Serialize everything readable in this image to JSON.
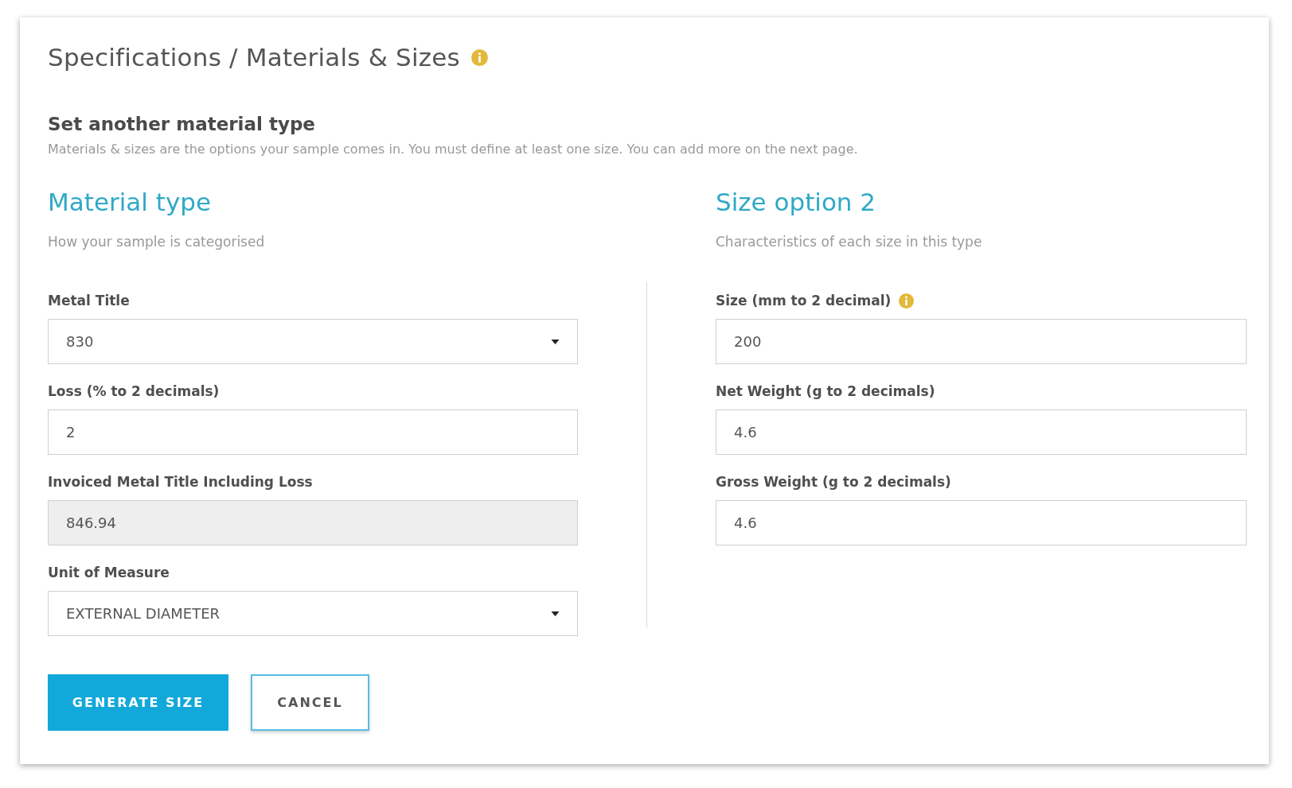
{
  "page_title": {
    "text": "Specifications / Materials & Sizes",
    "info": true
  },
  "section": {
    "heading": "Set another material type",
    "description": "Materials & sizes are the options your sample comes in. You must define at least one size. You can add more on the next page."
  },
  "columns": [
    {
      "title": "Material type",
      "subtitle": "How your sample is categorised",
      "fields": [
        {
          "label": "Metal Title",
          "kind": "select",
          "value": "830",
          "info": false,
          "disabled": false
        },
        {
          "label": "Loss (% to 2 decimals)",
          "kind": "text",
          "value": "2",
          "info": false,
          "disabled": false
        },
        {
          "label": "Invoiced Metal Title Including Loss",
          "kind": "text",
          "value": "846.94",
          "info": false,
          "disabled": true
        },
        {
          "label": "Unit of Measure",
          "kind": "select",
          "value": "EXTERNAL DIAMETER",
          "info": false,
          "disabled": false
        }
      ]
    },
    {
      "title": "Size option 2",
      "subtitle": "Characteristics of each size in this type",
      "fields": [
        {
          "label": "Size (mm to 2 decimal)",
          "kind": "text",
          "value": "200",
          "info": true,
          "disabled": false
        },
        {
          "label": "Net Weight (g to 2 decimals)",
          "kind": "text",
          "value": "4.6",
          "info": false,
          "disabled": false
        },
        {
          "label": "Gross Weight (g to 2 decimals)",
          "kind": "text",
          "value": "4.6",
          "info": false,
          "disabled": false
        }
      ]
    }
  ],
  "buttons": [
    {
      "label": "GENERATE SIZE",
      "kind": "primary"
    },
    {
      "label": "CANCEL",
      "kind": "secondary"
    }
  ]
}
